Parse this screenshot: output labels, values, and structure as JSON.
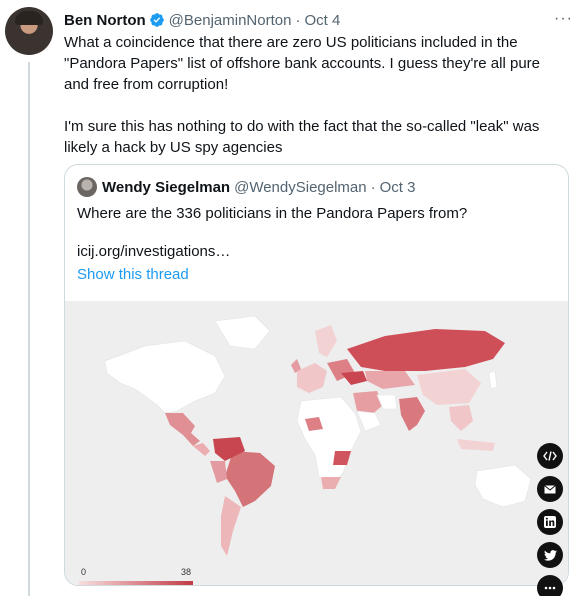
{
  "tweet": {
    "author_name": "Ben Norton",
    "handle": "@BenjaminNorton",
    "separator": "·",
    "date": "Oct 4",
    "more_label": "···",
    "text_p1": "What a coincidence that there are zero US politicians included in the \"Pandora Papers\" list of offshore bank accounts. I guess they're all pure and free from corruption!",
    "text_p2": "I'm sure this has nothing to do with the fact that the so-called \"leak\" was likely a hack by US spy agencies"
  },
  "quote": {
    "author_name": "Wendy Siegelman",
    "handle": "@WendySiegelman",
    "separator": "·",
    "date": "Oct 3",
    "text": "Where are the 336 politicians in the Pandora Papers from?",
    "link": "icij.org/investigations…",
    "show_thread": "Show this thread"
  },
  "map": {
    "legend_min": "0",
    "legend_max": "38",
    "low_color": "#f6dede",
    "high_color": "#c23a44"
  },
  "share_icons": [
    "embed-code-icon",
    "email-icon",
    "linkedin-icon",
    "twitter-icon",
    "more-share-icon"
  ],
  "colors": {
    "link": "#1d9bf0",
    "verified": "#1d9bf0",
    "muted_text": "#536471"
  }
}
